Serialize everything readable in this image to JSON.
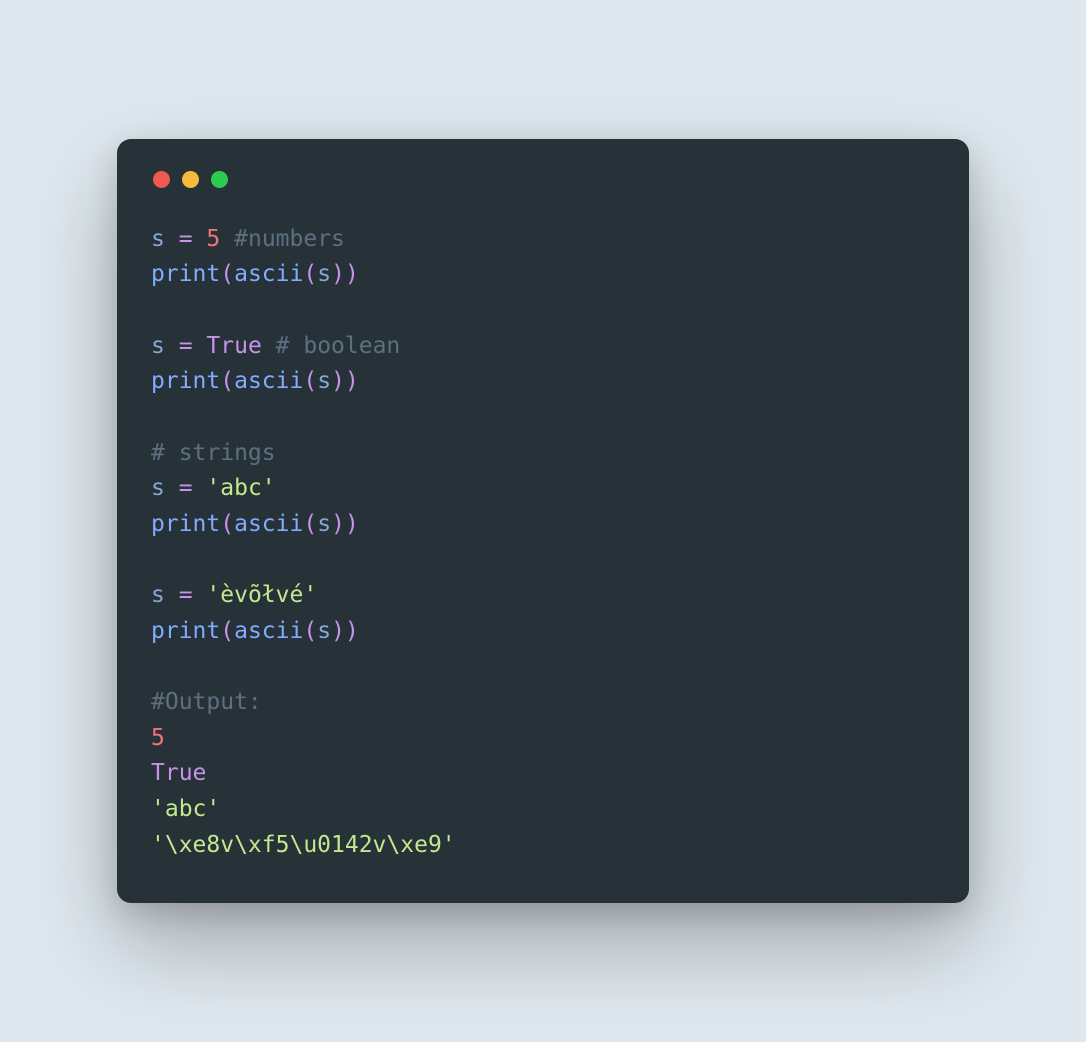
{
  "window": {
    "close_label": "close",
    "minimize_label": "minimize",
    "zoom_label": "zoom"
  },
  "code": {
    "l1_var": "s",
    "l1_eq": " = ",
    "l1_num": "5",
    "l1_sp": " ",
    "l1_comment": "#numbers",
    "l2_func1": "print",
    "l2_p1": "(",
    "l2_func2": "ascii",
    "l2_p2": "(",
    "l2_arg": "s",
    "l2_p3": ")",
    "l2_p4": ")",
    "l4_var": "s",
    "l4_eq": " = ",
    "l4_bool": "True",
    "l4_sp": " ",
    "l4_comment": "# boolean",
    "l5_func1": "print",
    "l5_p1": "(",
    "l5_func2": "ascii",
    "l5_p2": "(",
    "l5_arg": "s",
    "l5_p3": ")",
    "l5_p4": ")",
    "l7_comment": "# strings",
    "l8_var": "s",
    "l8_eq": " = ",
    "l8_str": "'abc'",
    "l9_func1": "print",
    "l9_p1": "(",
    "l9_func2": "ascii",
    "l9_p2": "(",
    "l9_arg": "s",
    "l9_p3": ")",
    "l9_p4": ")",
    "l11_var": "s",
    "l11_eq": " = ",
    "l11_str": "'èvõłvé'",
    "l12_func1": "print",
    "l12_p1": "(",
    "l12_func2": "ascii",
    "l12_p2": "(",
    "l12_arg": "s",
    "l12_p3": ")",
    "l12_p4": ")",
    "l14_comment": "#Output:",
    "l15_out": "5",
    "l16_out": "True",
    "l17_out": "'abc'",
    "l18_out": "'\\xe8v\\xf5\\u0142v\\xe9'"
  }
}
